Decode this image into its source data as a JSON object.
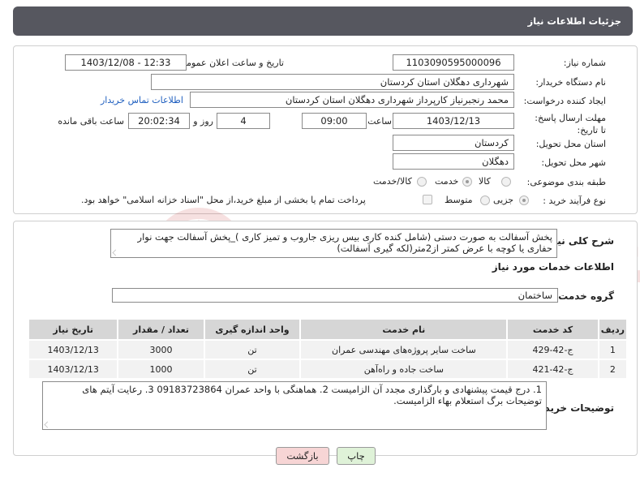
{
  "header": {
    "title": "جزئیات اطلاعات نیاز"
  },
  "form": {
    "need_number_label": "شماره نیاز:",
    "need_number": "1103090595000096",
    "announce_label": "تاریخ و ساعت اعلان عمومی:",
    "announce_value": "1403/12/08 - 12:33",
    "buyer_org_label": "نام دستگاه خریدار:",
    "buyer_org": "شهرداری دهگلان استان کردستان",
    "requester_label": "ایجاد کننده درخواست:",
    "requester": "محمد رنجبرنیاز کارپرداز شهرداری دهگلان استان کردستان",
    "contact_link": "اطلاعات تماس خریدار",
    "deadline_label": "مهلت ارسال پاسخ: تا تاریخ:",
    "deadline_date": "1403/12/13",
    "time_label": "ساعت",
    "deadline_time": "09:00",
    "days_value": "4",
    "days_label": "روز و",
    "remaining_time": "20:02:34",
    "remaining_label": "ساعت باقی مانده",
    "province_label": "استان محل تحویل:",
    "province": "کردستان",
    "city_label": "شهر محل تحویل:",
    "city": "دهگلان",
    "category_label": "طبقه بندی موضوعی:",
    "category_options": [
      "کالا",
      "خدمت",
      "کالا/خدمت"
    ],
    "category_selected": "خدمت",
    "process_label": "نوع فرآیند خرید :",
    "process_options": [
      "جزیی",
      "متوسط"
    ],
    "process_selected": "جزیی",
    "payment_note": "پرداخت تمام یا بخشی از مبلغ خرید،از محل \"اسناد خزانه اسلامی\" خواهد بود."
  },
  "details": {
    "summary_label": "شرح کلی نیاز:",
    "summary": "پخش آسفالت به صورت دستی (شامل کنده کاری بیس ریزی جاروب و تمیز کاری )_پخش آسفالت جهت نوار حفاری یا کوچه با عرض کمتر از2متر(لکه گیری آسفالت)",
    "services_heading": "اطلاعات خدمات مورد نیاز",
    "service_group_label": "گروه خدمت:",
    "service_group": "ساختمان",
    "table": {
      "headers": [
        "ردیف",
        "کد خدمت",
        "نام خدمت",
        "واحد اندازه گیری",
        "تعداد / مقدار",
        "تاریخ نیاز"
      ],
      "rows": [
        [
          "1",
          "ج-42-429",
          "ساخت سایر پروژه‌های مهندسی عمران",
          "تن",
          "3000",
          "1403/12/13"
        ],
        [
          "2",
          "ج-42-421",
          "ساخت جاده و راه‌آهن",
          "تن",
          "1000",
          "1403/12/13"
        ]
      ]
    },
    "buyer_notes_label": "توضیحات خریدار:",
    "buyer_notes": "1. درج قیمت پیشنهادی و بارگذاری مجدد آن الزامیست 2. هماهنگی با واحد عمران 09183723864  3. رعایت آیتم های توضیحات برگ استعلام بهاء الزامیست."
  },
  "buttons": {
    "print": "چاپ",
    "back": "بازگشت"
  },
  "colors": {
    "header_bg": "#56575f",
    "back_button_bg": "#f7d5d5",
    "print_button_bg": "#dff2d8",
    "link": "#1f5fbf"
  },
  "watermark_text": "AriaTender.neT"
}
